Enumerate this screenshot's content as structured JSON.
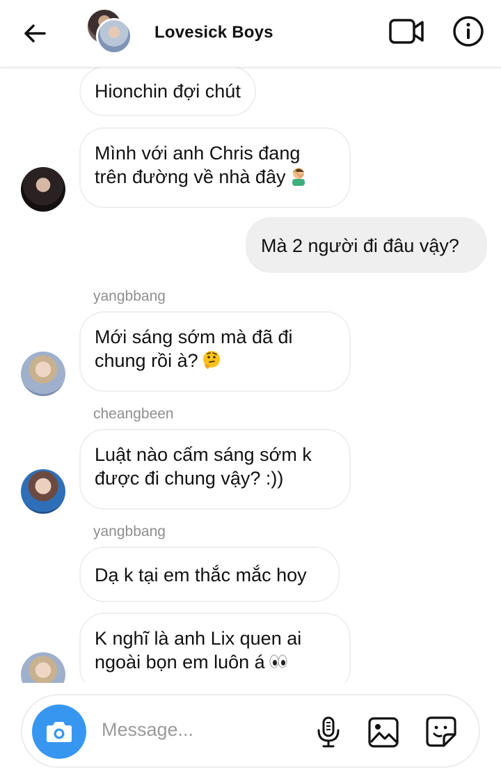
{
  "header": {
    "title": "Lovesick Boys"
  },
  "messages": [
    {
      "text": "Hionchin đợi chút"
    },
    {
      "line1": "Mình với anh Chris đang",
      "line2": "trên đường về nhà đây",
      "emoji": "facepalm-emoji"
    },
    {
      "text": "Mà 2 người đi đâu vậy?"
    },
    {
      "sender": "yangbbang",
      "line1": "Mới sáng sớm mà đã đi",
      "line2": "chung rồi à?",
      "emoji": "thinking-face-emoji"
    },
    {
      "sender": "cheangbeen",
      "line1": "Luật nào cấm sáng sớm k",
      "line2": "được đi chung vậy? :))"
    },
    {
      "sender": "yangbbang",
      "text": "Dạ k tại em thắc mắc hoy"
    },
    {
      "line1": "K nghĩ là anh Lix quen ai",
      "line2": "ngoài bọn em luôn á",
      "emoji": "eyes-emoji"
    }
  ],
  "composer": {
    "placeholder": "Message..."
  },
  "colors": {
    "accent": "#3797f0",
    "outgoing_bubble": "#efefef",
    "sender_text": "#8e8e8e"
  }
}
